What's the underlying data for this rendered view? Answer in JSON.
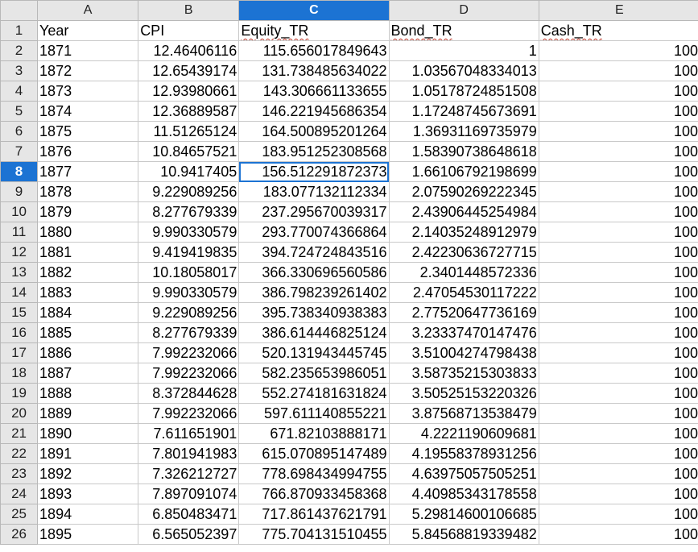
{
  "columns": [
    "A",
    "B",
    "C",
    "D",
    "E"
  ],
  "selected_column": "C",
  "selected_row": 8,
  "active_cell": "C8",
  "accent_color": "#1c73d3",
  "rows": [
    {
      "n": "1",
      "cells": [
        "Year",
        "CPI",
        "Equity_TR",
        "Bond_TR",
        "Cash_TR"
      ]
    },
    {
      "n": "2",
      "cells": [
        "1871",
        "12.46406116",
        "115.656017849643",
        "1",
        "100"
      ]
    },
    {
      "n": "3",
      "cells": [
        "1872",
        "12.65439174",
        "131.738485634022",
        "1.03567048334013",
        "100"
      ]
    },
    {
      "n": "4",
      "cells": [
        "1873",
        "12.93980661",
        "143.306661133655",
        "1.05178724851508",
        "100"
      ]
    },
    {
      "n": "5",
      "cells": [
        "1874",
        "12.36889587",
        "146.221945686354",
        "1.17248745673691",
        "100"
      ]
    },
    {
      "n": "6",
      "cells": [
        "1875",
        "11.51265124",
        "164.500895201264",
        "1.36931169735979",
        "100"
      ]
    },
    {
      "n": "7",
      "cells": [
        "1876",
        "10.84657521",
        "183.951252308568",
        "1.58390738648618",
        "100"
      ]
    },
    {
      "n": "8",
      "cells": [
        "1877",
        "10.9417405",
        "156.512291872373",
        "1.66106792198699",
        "100"
      ]
    },
    {
      "n": "9",
      "cells": [
        "1878",
        "9.229089256",
        "183.077132112334",
        "2.07590269222345",
        "100"
      ]
    },
    {
      "n": "10",
      "cells": [
        "1879",
        "8.277679339",
        "237.295670039317",
        "2.43906445254984",
        "100"
      ]
    },
    {
      "n": "11",
      "cells": [
        "1880",
        "9.990330579",
        "293.770074366864",
        "2.14035248912979",
        "100"
      ]
    },
    {
      "n": "12",
      "cells": [
        "1881",
        "9.419419835",
        "394.724724843516",
        "2.42230636727715",
        "100"
      ]
    },
    {
      "n": "13",
      "cells": [
        "1882",
        "10.18058017",
        "366.330696560586",
        "2.3401448572336",
        "100"
      ]
    },
    {
      "n": "14",
      "cells": [
        "1883",
        "9.990330579",
        "386.798239261402",
        "2.47054530117222",
        "100"
      ]
    },
    {
      "n": "15",
      "cells": [
        "1884",
        "9.229089256",
        "395.738340938383",
        "2.77520647736169",
        "100"
      ]
    },
    {
      "n": "16",
      "cells": [
        "1885",
        "8.277679339",
        "386.614446825124",
        "3.23337470147476",
        "100"
      ]
    },
    {
      "n": "17",
      "cells": [
        "1886",
        "7.992232066",
        "520.131943445745",
        "3.51004274798438",
        "100"
      ]
    },
    {
      "n": "18",
      "cells": [
        "1887",
        "7.992232066",
        "582.235653986051",
        "3.58735215303833",
        "100"
      ]
    },
    {
      "n": "19",
      "cells": [
        "1888",
        "8.372844628",
        "552.274181631824",
        "3.50525153220326",
        "100"
      ]
    },
    {
      "n": "20",
      "cells": [
        "1889",
        "7.992232066",
        "597.611140855221",
        "3.87568713538479",
        "100"
      ]
    },
    {
      "n": "21",
      "cells": [
        "1890",
        "7.611651901",
        "671.82103888171",
        "4.2221190609681",
        "100"
      ]
    },
    {
      "n": "22",
      "cells": [
        "1891",
        "7.801941983",
        "615.070895147489",
        "4.19558378931256",
        "100"
      ]
    },
    {
      "n": "23",
      "cells": [
        "1892",
        "7.326212727",
        "778.698434994755",
        "4.63975057505251",
        "100"
      ]
    },
    {
      "n": "24",
      "cells": [
        "1893",
        "7.897091074",
        "766.870933458368",
        "4.40985343178558",
        "100"
      ]
    },
    {
      "n": "25",
      "cells": [
        "1894",
        "6.850483471",
        "717.861437621791",
        "5.29814600106685",
        "100"
      ]
    },
    {
      "n": "26",
      "cells": [
        "1895",
        "6.565052397",
        "775.704131510455",
        "5.84568819339482",
        "100"
      ]
    }
  ]
}
